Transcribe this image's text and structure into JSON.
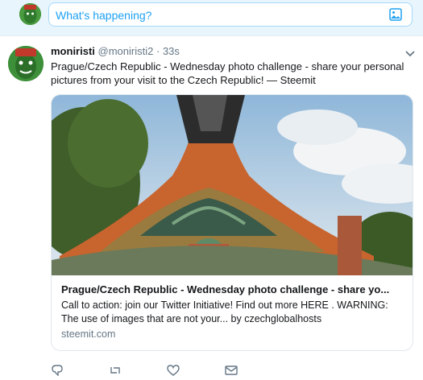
{
  "composer": {
    "placeholder": "What's happening?",
    "media_icon": "image-icon"
  },
  "tweet": {
    "display_name": "moniristi",
    "handle": "@moniristi2",
    "separator": "·",
    "time": "33s",
    "menu_icon": "chevron-down-icon",
    "text": "Prague/Czech Republic - Wednesday photo challenge - share your personal pictures from your visit to the Czech Republic! — Steemit",
    "card": {
      "title": "Prague/Czech Republic - Wednesday photo challenge - share yo...",
      "description": "Call to action: join our Twitter Initiative! Find out more HERE . WARNING: The use of images that are not your... by czechglobalhosts",
      "domain": "steemit.com"
    },
    "actions": [
      "reply-icon",
      "retweet-icon",
      "like-icon",
      "dm-icon"
    ]
  },
  "colors": {
    "accent": "#1da1f2",
    "composer_bg": "#e8f5fd",
    "secondary_text": "#657786"
  }
}
